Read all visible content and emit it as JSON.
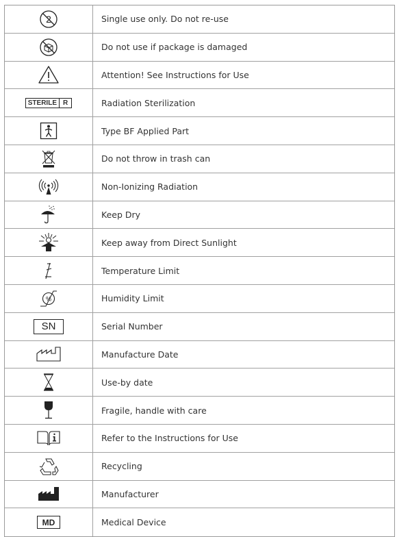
{
  "rows": [
    {
      "icon": "single-use-icon",
      "label": "Single use only. Do not re-use"
    },
    {
      "icon": "do-not-use-if-damaged-icon",
      "label": "Do not use if package is damaged"
    },
    {
      "icon": "attention-warning-icon",
      "label": "Attention! See Instructions for Use"
    },
    {
      "icon": "sterile-r-icon",
      "label": "Radiation Sterilization",
      "badge": [
        "STERILE",
        "R"
      ]
    },
    {
      "icon": "type-bf-applied-part-icon",
      "label": "Type BF Applied Part"
    },
    {
      "icon": "weee-crossed-bin-icon",
      "label": "Do not throw in trash can"
    },
    {
      "icon": "non-ionizing-radiation-icon",
      "label": "Non-Ionizing Radiation"
    },
    {
      "icon": "keep-dry-umbrella-icon",
      "label": "Keep Dry"
    },
    {
      "icon": "keep-from-sunlight-icon",
      "label": "Keep away from Direct Sunlight"
    },
    {
      "icon": "temperature-limit-icon",
      "label": "Temperature Limit"
    },
    {
      "icon": "humidity-limit-icon",
      "label": "Humidity Limit"
    },
    {
      "icon": "serial-number-icon",
      "label": "Serial Number",
      "badge": "SN"
    },
    {
      "icon": "manufacture-date-icon",
      "label": "Manufacture Date"
    },
    {
      "icon": "use-by-date-hourglass-icon",
      "label": "Use-by date"
    },
    {
      "icon": "fragile-glass-icon",
      "label": "Fragile, handle with care"
    },
    {
      "icon": "instructions-book-icon",
      "label": "Refer to the Instructions for Use"
    },
    {
      "icon": "recycling-icon",
      "label": "Recycling"
    },
    {
      "icon": "manufacturer-factory-icon",
      "label": "Manufacturer"
    },
    {
      "icon": "medical-device-icon",
      "label": "Medical Device",
      "badge": "MD"
    }
  ]
}
